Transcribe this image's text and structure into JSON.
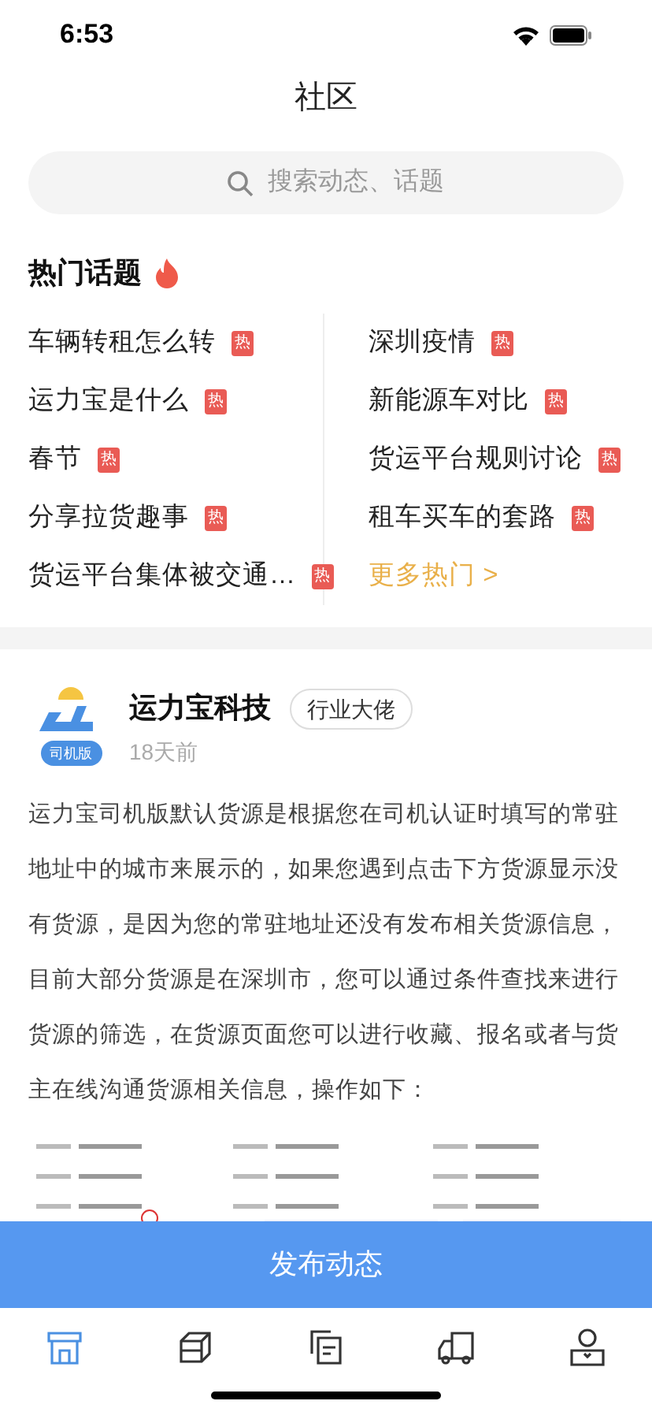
{
  "status_bar": {
    "time": "6:53"
  },
  "header": {
    "title": "社区"
  },
  "search": {
    "placeholder": "搜索动态、话题"
  },
  "hot_topics": {
    "title": "热门话题",
    "columns": [
      [
        {
          "label": "车辆转租怎么转",
          "badge": "热"
        },
        {
          "label": "运力宝是什么",
          "badge": "热"
        },
        {
          "label": "春节",
          "badge": "热"
        },
        {
          "label": "分享拉货趣事",
          "badge": "热"
        },
        {
          "label": "货运平台集体被交通…",
          "badge": "热"
        }
      ],
      [
        {
          "label": "深圳疫情",
          "badge": "热"
        },
        {
          "label": "新能源车对比",
          "badge": "热"
        },
        {
          "label": "货运平台规则讨论",
          "badge": "热"
        },
        {
          "label": "租车买车的套路",
          "badge": "热"
        }
      ]
    ],
    "more_link": "更多热门 >"
  },
  "post": {
    "author": "运力宝科技",
    "author_tag": "行业大佬",
    "version_badge": "司机版",
    "time": "18天前",
    "body": "运力宝司机版默认货源是根据您在司机认证时填写的常驻地址中的城市来展示的，如果您遇到点击下方货源显示没有货源，是因为您的常驻地址还没有发布相关货源信息，目前大部分货源是在深圳市，您可以通过条件查找来进行货源的筛选，在货源页面您可以进行收藏、报名或者与货主在线沟通货源相关信息，操作如下："
  },
  "publish_button": "发布动态",
  "tab_bar": [
    {
      "kind": "store",
      "selected": true
    },
    {
      "kind": "box",
      "selected": false
    },
    {
      "kind": "document",
      "selected": false
    },
    {
      "kind": "truck",
      "selected": false
    },
    {
      "kind": "person",
      "selected": false
    }
  ]
}
